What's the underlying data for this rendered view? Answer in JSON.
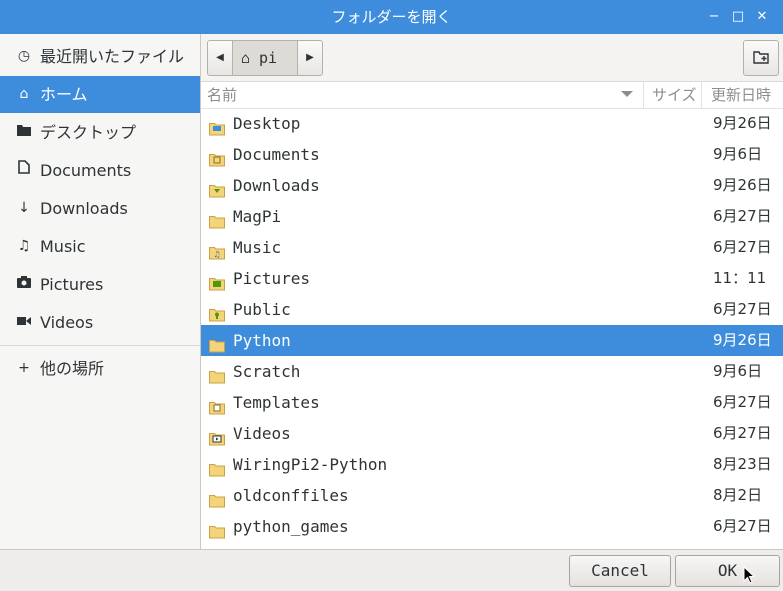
{
  "window": {
    "title": "フォルダーを開く",
    "controls": [
      "−",
      "□",
      "✕"
    ]
  },
  "sidebar": {
    "items": [
      {
        "icon": "recent-icon",
        "label": "最近開いたファイル",
        "selected": false
      },
      {
        "icon": "home-icon",
        "label": "ホーム",
        "selected": true
      },
      {
        "icon": "folder-icon",
        "label": "デスクトップ",
        "selected": false
      },
      {
        "icon": "document-icon",
        "label": "Documents",
        "selected": false
      },
      {
        "icon": "download-icon",
        "label": "Downloads",
        "selected": false
      },
      {
        "icon": "music-icon",
        "label": "Music",
        "selected": false
      },
      {
        "icon": "camera-icon",
        "label": "Pictures",
        "selected": false
      },
      {
        "icon": "video-icon",
        "label": "Videos",
        "selected": false
      }
    ],
    "other_locations": {
      "icon": "plus-icon",
      "label": "他の場所"
    }
  },
  "pathbar": {
    "crumb": "pi",
    "crumb_icon": "home-icon"
  },
  "list": {
    "headers": {
      "name": "名前",
      "size": "サイズ",
      "modified": "更新日時"
    },
    "rows": [
      {
        "name": "Desktop",
        "date": "9月26日",
        "icon": "desktop-folder-icon",
        "selected": false
      },
      {
        "name": "Documents",
        "date": "9月6日",
        "icon": "documents-folder-icon",
        "selected": false
      },
      {
        "name": "Downloads",
        "date": "9月26日",
        "icon": "downloads-folder-icon",
        "selected": false
      },
      {
        "name": "MagPi",
        "date": "6月27日",
        "icon": "folder-icon",
        "selected": false
      },
      {
        "name": "Music",
        "date": "6月27日",
        "icon": "music-folder-icon",
        "selected": false
      },
      {
        "name": "Pictures",
        "date": "11：11",
        "icon": "pictures-folder-icon",
        "selected": false
      },
      {
        "name": "Public",
        "date": "6月27日",
        "icon": "public-folder-icon",
        "selected": false
      },
      {
        "name": "Python",
        "date": "9月26日",
        "icon": "folder-icon",
        "selected": true
      },
      {
        "name": "Scratch",
        "date": "9月6日",
        "icon": "folder-icon",
        "selected": false
      },
      {
        "name": "Templates",
        "date": "6月27日",
        "icon": "templates-folder-icon",
        "selected": false
      },
      {
        "name": "Videos",
        "date": "6月27日",
        "icon": "videos-folder-icon",
        "selected": false
      },
      {
        "name": "WiringPi2-Python",
        "date": "8月23日",
        "icon": "folder-icon",
        "selected": false
      },
      {
        "name": "oldconffiles",
        "date": "8月2日",
        "icon": "folder-icon",
        "selected": false
      },
      {
        "name": "python_games",
        "date": "6月27日",
        "icon": "folder-icon",
        "selected": false
      }
    ]
  },
  "actions": {
    "cancel": "Cancel",
    "ok": "OK"
  },
  "colors": {
    "accent": "#3e8ddc",
    "folder": "#f5d37b",
    "folder_border": "#c9a343"
  }
}
